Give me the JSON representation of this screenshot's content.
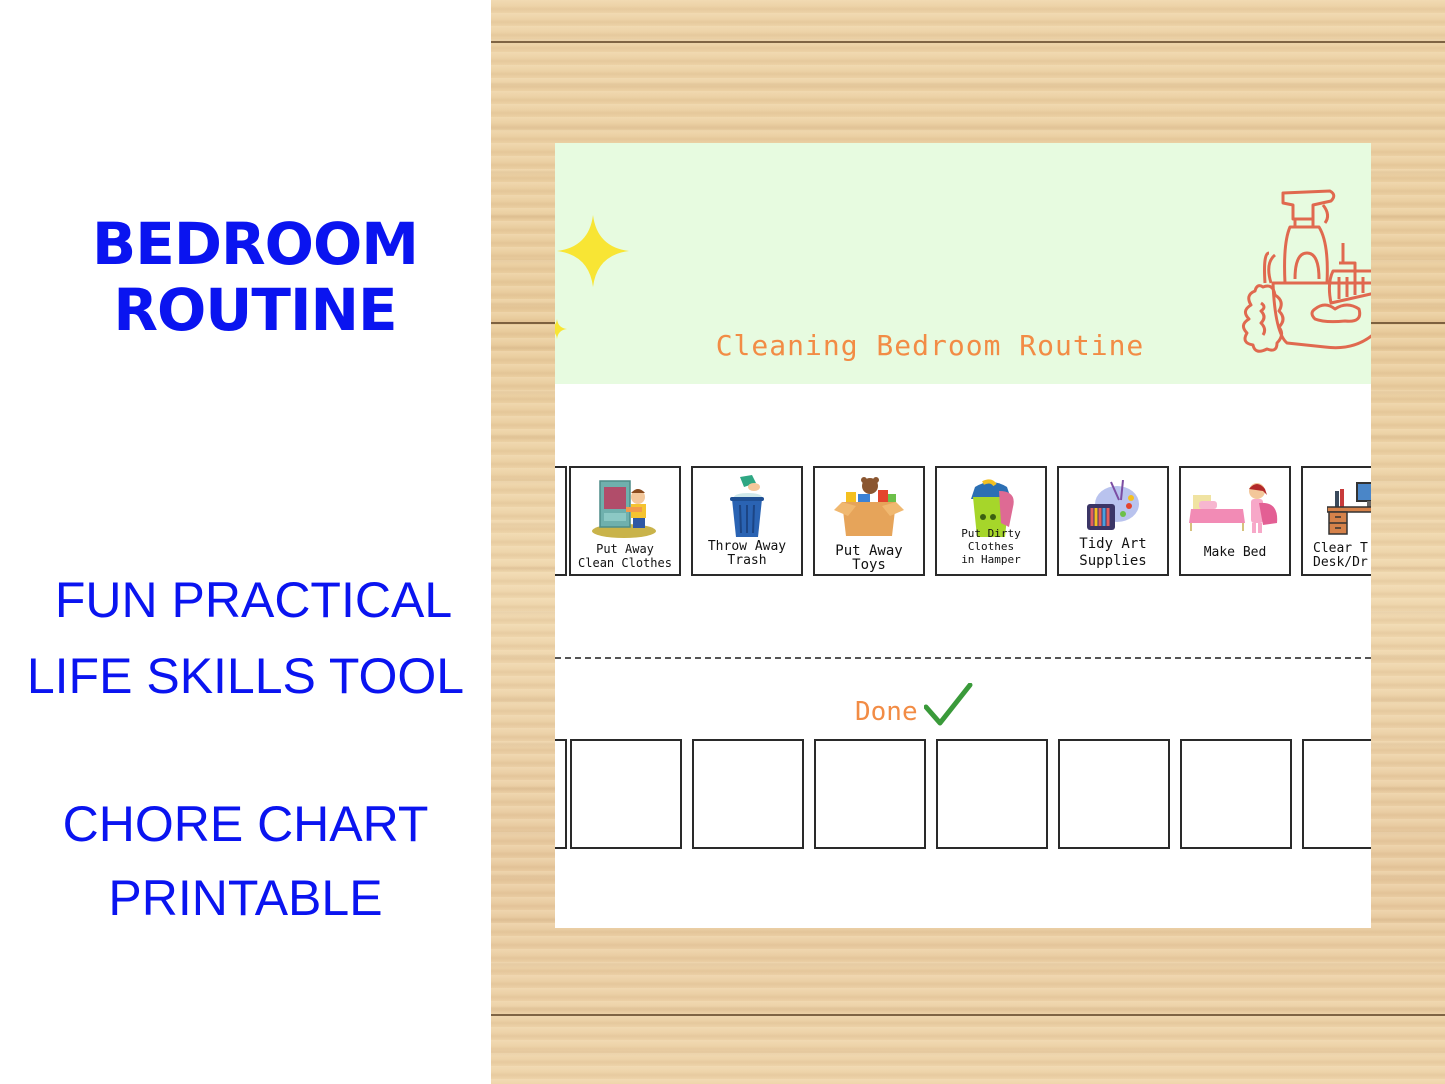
{
  "promo": {
    "title_line1": "BEDROOM",
    "title_line2": "ROUTINE",
    "subtitle_line1": "FUN PRACTICAL",
    "subtitle_line2": "LIFE SKILLS TOOL",
    "subtitle_line3": "CHORE CHART",
    "subtitle_line4": "PRINTABLE",
    "text_color": "#0a14f0"
  },
  "chart": {
    "title": "Cleaning Bedroom Routine",
    "header_bg": "#e7fbe0",
    "accent_color": "#f28c45",
    "tasks": [
      {
        "label_line1": "",
        "label_line2": "",
        "icon": "partial-card"
      },
      {
        "label_line1": "Put Away",
        "label_line2": "Clean Clothes",
        "icon": "wardrobe-boy-icon"
      },
      {
        "label_line1": "Throw Away",
        "label_line2": "Trash",
        "icon": "trash-can-icon"
      },
      {
        "label_line1": "Put Away",
        "label_line2": "Toys",
        "icon": "toy-box-icon"
      },
      {
        "label_line1": "Put Dirty Clothes",
        "label_line2": "in Hamper",
        "icon": "laundry-hamper-icon"
      },
      {
        "label_line1": "Tidy Art",
        "label_line2": "Supplies",
        "icon": "art-supplies-icon"
      },
      {
        "label_line1": "Make Bed",
        "label_line2": "",
        "icon": "bed-girl-icon"
      },
      {
        "label_line1": "Clear T",
        "label_line2": "Desk/Dr",
        "icon": "desk-computer-icon"
      }
    ],
    "done_label": "Done",
    "done_icon": "checkmark-icon",
    "done_slots": 8
  }
}
